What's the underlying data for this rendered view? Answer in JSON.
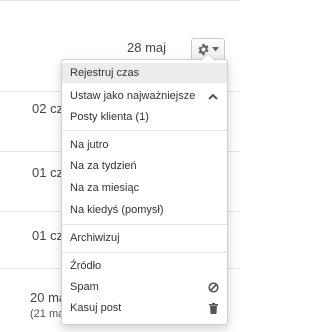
{
  "rows": [
    {
      "date": "28 maj"
    },
    {
      "date": "02 cz"
    },
    {
      "date": "01 cz"
    },
    {
      "date": "01 cz"
    },
    {
      "date": "20 ma",
      "subdate": "(21 ma"
    }
  ],
  "dropdown_button": {
    "icon": "gear-icon",
    "arrow_icon": "caret-down-icon"
  },
  "menu": {
    "items": {
      "register_time": "Rejestruj czas",
      "set_important": "Ustaw jako najważniejsze",
      "client_posts": "Posty klienta (1)",
      "tomorrow": "Na jutro",
      "next_week": "Na za tydzień",
      "next_month": "Na za miesiąc",
      "someday": "Na kiedyś (pomysł)",
      "archive": "Archiwizuj",
      "source": "Źródło",
      "spam": "Spam",
      "delete_post": "Kasuj post"
    },
    "icons": {
      "set_important": "chevron-up-icon",
      "spam": "ban-icon",
      "delete_post": "trash-icon"
    }
  },
  "colors": {
    "hover_background": "#ececec",
    "divider": "#e5e5e5",
    "text": "#333333"
  }
}
